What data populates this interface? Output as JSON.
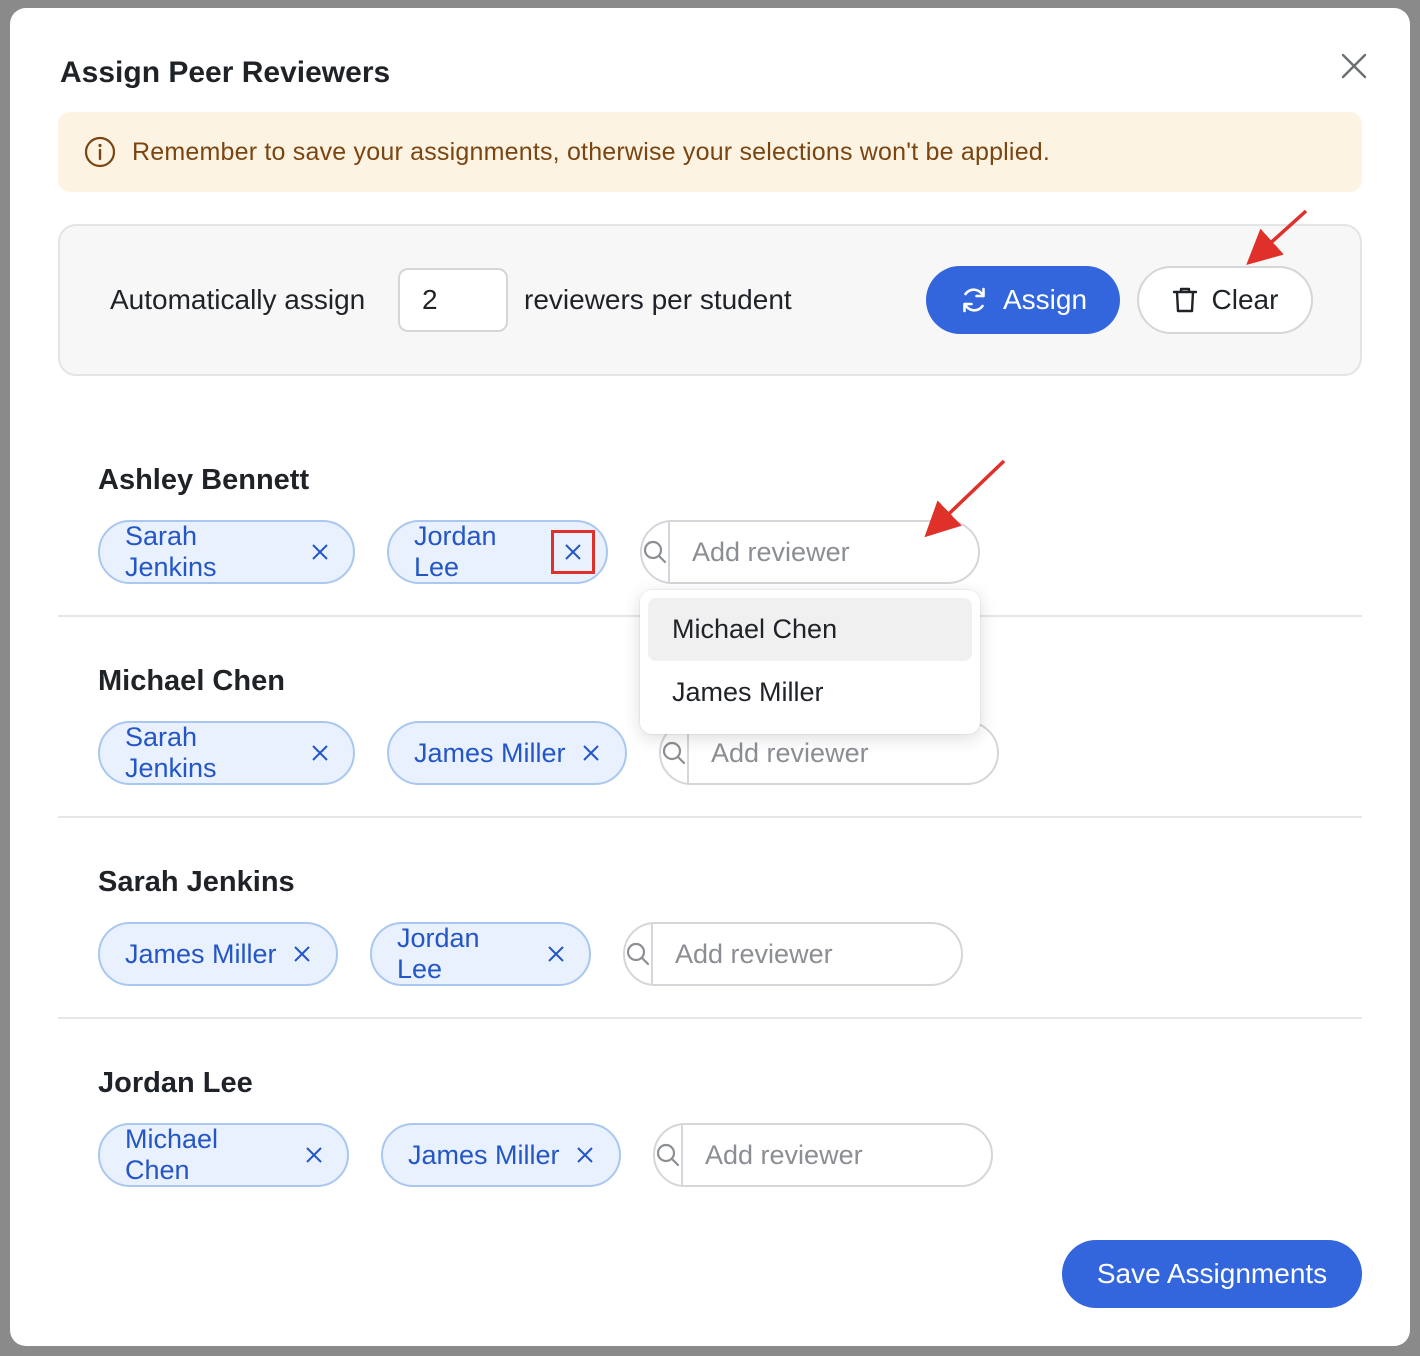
{
  "modal": {
    "title": "Assign Peer Reviewers",
    "notice": "Remember to save your assignments, otherwise your selections won't be applied."
  },
  "auto_assign": {
    "label_before": "Automatically assign",
    "count_value": "2",
    "label_after": "reviewers per student",
    "assign_label": "Assign",
    "clear_label": "Clear"
  },
  "add_reviewer_placeholder": "Add reviewer",
  "students": [
    {
      "name": "Ashley Bennett",
      "reviewers": [
        "Sarah Jenkins",
        "Jordan Lee"
      ]
    },
    {
      "name": "Michael Chen",
      "reviewers": [
        "Sarah Jenkins",
        "James Miller"
      ]
    },
    {
      "name": "Sarah Jenkins",
      "reviewers": [
        "James Miller",
        "Jordan Lee"
      ]
    },
    {
      "name": "Jordan Lee",
      "reviewers": [
        "Michael Chen",
        "James Miller"
      ]
    }
  ],
  "dropdown": {
    "options": [
      "Michael Chen",
      "James Miller"
    ]
  },
  "footer": {
    "save_label": "Save Assignments"
  },
  "colors": {
    "accent": "#3366dd",
    "chip_bg": "#e8f1fd",
    "chip_border": "#a9c7f0",
    "chip_text": "#2456c6",
    "notice_bg": "#fdf3e3",
    "notice_text": "#7a4510",
    "annotation": "#e0302a"
  }
}
